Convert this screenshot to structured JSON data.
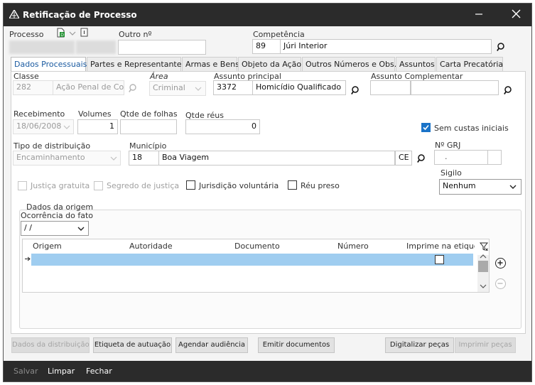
{
  "window": {
    "title": "Retificação de Processo"
  },
  "header": {
    "processo_label": "Processo",
    "outro_label": "Outro nº",
    "competencia_label": "Competência",
    "competencia_code": "89",
    "competencia_value": "Júri Interior"
  },
  "tabs": [
    {
      "label": "Dados Processuais"
    },
    {
      "label": "Partes e Representantes"
    },
    {
      "label": "Armas e Bens"
    },
    {
      "label": "Objeto da Ação"
    },
    {
      "label": "Outros Números e Obs."
    },
    {
      "label": "Assuntos"
    },
    {
      "label": "Carta Precatória"
    }
  ],
  "form": {
    "classe_label": "Classe",
    "classe_code": "282",
    "classe_value": "Ação Penal de Com",
    "area_label": "Área",
    "area_value": "Criminal",
    "assunto_principal_label": "Assunto principal",
    "assunto_principal_code": "3372",
    "assunto_principal_value": "Homicídio Qualificado",
    "assunto_complementar_label": "Assunto Complementar",
    "recebimento_label": "Recebimento",
    "recebimento_value": "18/06/2008",
    "volumes_label": "Volumes",
    "volumes_value": "1",
    "folhas_label": "Qtde de folhas",
    "reus_label": "Qtde réus",
    "reus_value": "0",
    "sem_custas_label": "Sem custas iniciais",
    "tipo_dist_label": "Tipo de distribuição",
    "tipo_dist_value": "Encaminhamento",
    "municipio_label": "Município",
    "municipio_code": "18",
    "municipio_value": "Boa Viagem",
    "uf_value": "CE",
    "grj_label": "Nº GRJ",
    "grj_value": ".",
    "justica_gratuita_label": "Justiça gratuita",
    "segredo_label": "Segredo de justiça",
    "jurisdicao_label": "Jurisdição voluntária",
    "reu_preso_label": "Réu preso",
    "sigilo_label": "Sigilo",
    "sigilo_value": "Nenhum"
  },
  "origem": {
    "section_title": "Dados da origem",
    "ocorrencia_label": "Ocorrência do fato",
    "ocorrencia_value": " /  /",
    "columns": [
      "Origem",
      "Autoridade",
      "Documento",
      "Número",
      "Imprime na etiquet"
    ]
  },
  "buttons": {
    "dados_distribuicao": "Dados da distribuição",
    "etiqueta": "Etiqueta de autuação",
    "agendar": "Agendar audiência",
    "emitir": "Emitir documentos",
    "digitalizar": "Digitalizar peças",
    "imprimir": "Imprimir peças"
  },
  "footer": {
    "salvar": "Salvar",
    "limpar": "Limpar",
    "fechar": "Fechar"
  },
  "colors": {
    "titlebar": "#2b2b2b",
    "accent": "#1a73c8",
    "selected_row": "#9fcdf0"
  }
}
